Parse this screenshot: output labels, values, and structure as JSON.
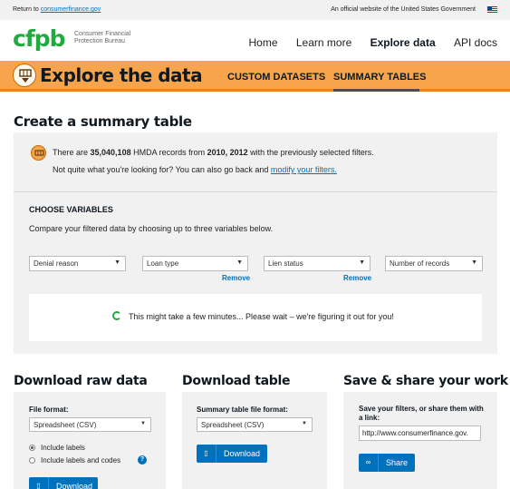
{
  "topbar": {
    "return_prefix": "Return to ",
    "return_link": "consumerfinance.gov",
    "gov_notice": "An official website of the United States Government"
  },
  "header": {
    "logo_text": "cfpb",
    "logo_subtitle": "Consumer Financial Protection Bureau",
    "nav": [
      "Home",
      "Learn more",
      "Explore data",
      "API docs"
    ],
    "nav_active": "Explore data"
  },
  "banner": {
    "title": "Explore the data",
    "tabs": [
      "CUSTOM DATASETS",
      "SUMMARY TABLES"
    ],
    "active_tab": "SUMMARY TABLES"
  },
  "page_title": "Create a summary table",
  "records": {
    "prefix": "There are ",
    "count": "35,040,108",
    "middle": " HMDA records from ",
    "years": "2010, 2012",
    "suffix": " with the previously selected filters.",
    "line2_text": "Not quite what you're looking for? You can also go back and ",
    "line2_link": "modify your filters."
  },
  "variables": {
    "heading": "CHOOSE VARIABLES",
    "description": "Compare your filtered data by choosing up to three variables below.",
    "selects": [
      "Denial reason",
      "Loan type",
      "Lien status",
      "Number of records"
    ],
    "remove_label": "Remove"
  },
  "wait_message": "This might take a few minutes... Please wait – we're figuring it out for you!",
  "download_raw": {
    "heading": "Download raw data",
    "format_label": "File format:",
    "format_value": "Spreadsheet (CSV)",
    "option1": "Include labels",
    "option2": "Include labels and codes",
    "help": "?",
    "button": "Download"
  },
  "download_table": {
    "heading": "Download table",
    "format_label": "Summary table file format:",
    "format_value": "Spreadsheet (CSV)",
    "button": "Download"
  },
  "share": {
    "heading": "Save & share your work",
    "label": "Save your filters, or share them with a link:",
    "url": "http://www.consumerfinance.gov.",
    "button": "Share"
  },
  "colors": {
    "banner_orange": "#f6a54d",
    "brand_green": "#20aa3f",
    "link_blue": "#0071bc",
    "panel_grey": "#f1f1f1"
  }
}
